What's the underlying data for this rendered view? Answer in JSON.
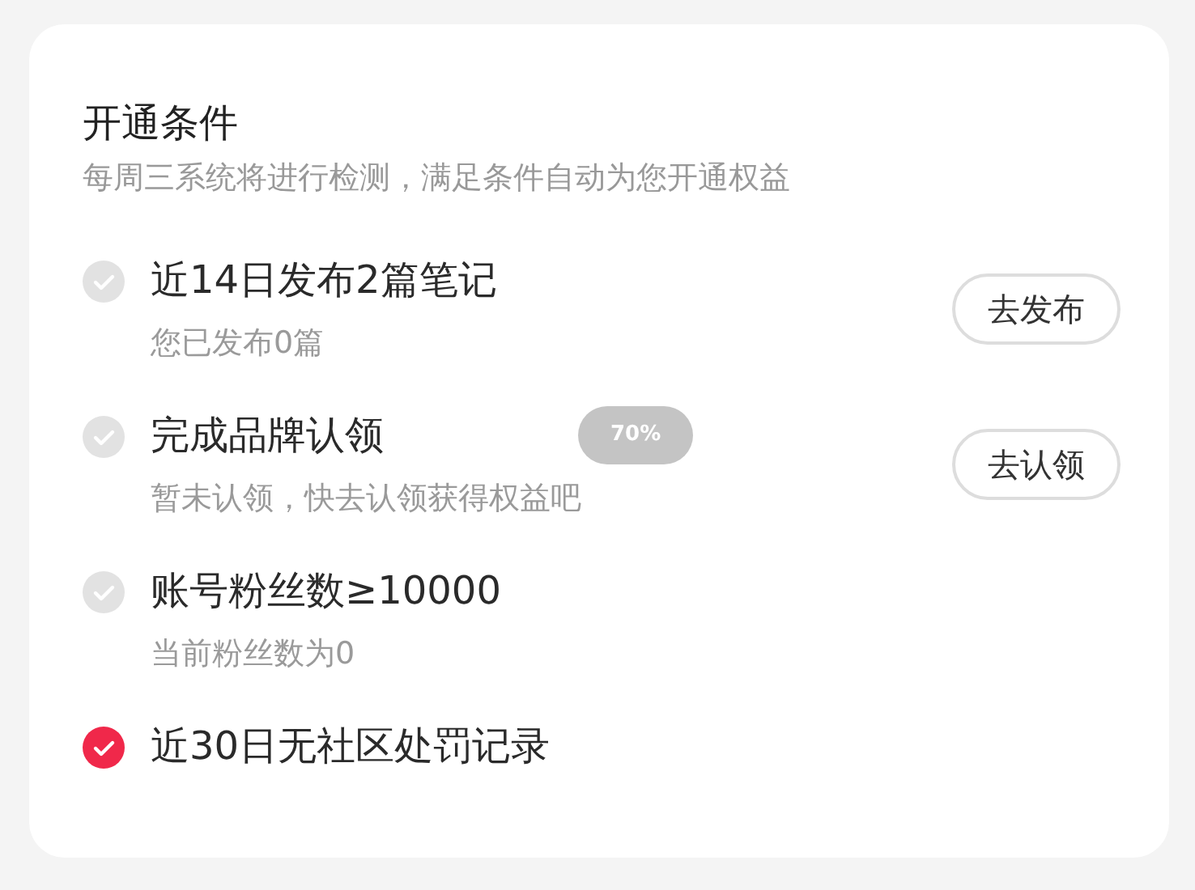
{
  "card": {
    "title": "开通条件",
    "subtitle": "每周三系统将进行检测，满足条件自动为您开通权益"
  },
  "conditions": [
    {
      "title": "近14日发布2篇笔记",
      "detail": "您已发布0篇",
      "met": false,
      "action": "去发布"
    },
    {
      "title": "完成品牌认领",
      "detail": "暂未认领，快去认领获得权益吧",
      "met": false,
      "action": "去认领",
      "badge": "70%"
    },
    {
      "title": "账号粉丝数≥10000",
      "detail": "当前粉丝数为0",
      "met": false
    },
    {
      "title": "近30日无社区处罚记录",
      "met": true
    }
  ]
}
